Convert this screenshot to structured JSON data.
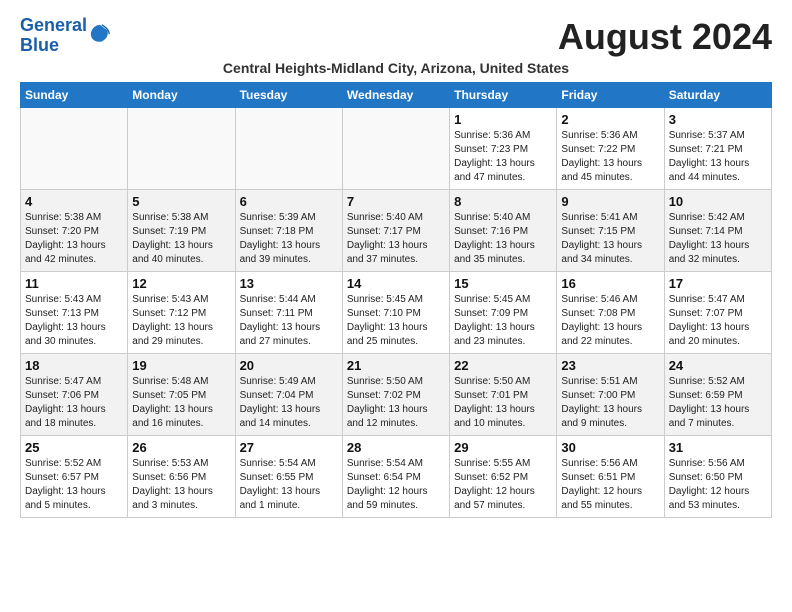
{
  "header": {
    "logo_line1": "General",
    "logo_line2": "Blue",
    "month": "August 2024",
    "location": "Central Heights-Midland City, Arizona, United States"
  },
  "weekdays": [
    "Sunday",
    "Monday",
    "Tuesday",
    "Wednesday",
    "Thursday",
    "Friday",
    "Saturday"
  ],
  "weeks": [
    [
      {
        "day": "",
        "sunrise": "",
        "sunset": "",
        "daylight": ""
      },
      {
        "day": "",
        "sunrise": "",
        "sunset": "",
        "daylight": ""
      },
      {
        "day": "",
        "sunrise": "",
        "sunset": "",
        "daylight": ""
      },
      {
        "day": "",
        "sunrise": "",
        "sunset": "",
        "daylight": ""
      },
      {
        "day": "1",
        "sunrise": "Sunrise: 5:36 AM",
        "sunset": "Sunset: 7:23 PM",
        "daylight": "Daylight: 13 hours and 47 minutes."
      },
      {
        "day": "2",
        "sunrise": "Sunrise: 5:36 AM",
        "sunset": "Sunset: 7:22 PM",
        "daylight": "Daylight: 13 hours and 45 minutes."
      },
      {
        "day": "3",
        "sunrise": "Sunrise: 5:37 AM",
        "sunset": "Sunset: 7:21 PM",
        "daylight": "Daylight: 13 hours and 44 minutes."
      }
    ],
    [
      {
        "day": "4",
        "sunrise": "Sunrise: 5:38 AM",
        "sunset": "Sunset: 7:20 PM",
        "daylight": "Daylight: 13 hours and 42 minutes."
      },
      {
        "day": "5",
        "sunrise": "Sunrise: 5:38 AM",
        "sunset": "Sunset: 7:19 PM",
        "daylight": "Daylight: 13 hours and 40 minutes."
      },
      {
        "day": "6",
        "sunrise": "Sunrise: 5:39 AM",
        "sunset": "Sunset: 7:18 PM",
        "daylight": "Daylight: 13 hours and 39 minutes."
      },
      {
        "day": "7",
        "sunrise": "Sunrise: 5:40 AM",
        "sunset": "Sunset: 7:17 PM",
        "daylight": "Daylight: 13 hours and 37 minutes."
      },
      {
        "day": "8",
        "sunrise": "Sunrise: 5:40 AM",
        "sunset": "Sunset: 7:16 PM",
        "daylight": "Daylight: 13 hours and 35 minutes."
      },
      {
        "day": "9",
        "sunrise": "Sunrise: 5:41 AM",
        "sunset": "Sunset: 7:15 PM",
        "daylight": "Daylight: 13 hours and 34 minutes."
      },
      {
        "day": "10",
        "sunrise": "Sunrise: 5:42 AM",
        "sunset": "Sunset: 7:14 PM",
        "daylight": "Daylight: 13 hours and 32 minutes."
      }
    ],
    [
      {
        "day": "11",
        "sunrise": "Sunrise: 5:43 AM",
        "sunset": "Sunset: 7:13 PM",
        "daylight": "Daylight: 13 hours and 30 minutes."
      },
      {
        "day": "12",
        "sunrise": "Sunrise: 5:43 AM",
        "sunset": "Sunset: 7:12 PM",
        "daylight": "Daylight: 13 hours and 29 minutes."
      },
      {
        "day": "13",
        "sunrise": "Sunrise: 5:44 AM",
        "sunset": "Sunset: 7:11 PM",
        "daylight": "Daylight: 13 hours and 27 minutes."
      },
      {
        "day": "14",
        "sunrise": "Sunrise: 5:45 AM",
        "sunset": "Sunset: 7:10 PM",
        "daylight": "Daylight: 13 hours and 25 minutes."
      },
      {
        "day": "15",
        "sunrise": "Sunrise: 5:45 AM",
        "sunset": "Sunset: 7:09 PM",
        "daylight": "Daylight: 13 hours and 23 minutes."
      },
      {
        "day": "16",
        "sunrise": "Sunrise: 5:46 AM",
        "sunset": "Sunset: 7:08 PM",
        "daylight": "Daylight: 13 hours and 22 minutes."
      },
      {
        "day": "17",
        "sunrise": "Sunrise: 5:47 AM",
        "sunset": "Sunset: 7:07 PM",
        "daylight": "Daylight: 13 hours and 20 minutes."
      }
    ],
    [
      {
        "day": "18",
        "sunrise": "Sunrise: 5:47 AM",
        "sunset": "Sunset: 7:06 PM",
        "daylight": "Daylight: 13 hours and 18 minutes."
      },
      {
        "day": "19",
        "sunrise": "Sunrise: 5:48 AM",
        "sunset": "Sunset: 7:05 PM",
        "daylight": "Daylight: 13 hours and 16 minutes."
      },
      {
        "day": "20",
        "sunrise": "Sunrise: 5:49 AM",
        "sunset": "Sunset: 7:04 PM",
        "daylight": "Daylight: 13 hours and 14 minutes."
      },
      {
        "day": "21",
        "sunrise": "Sunrise: 5:50 AM",
        "sunset": "Sunset: 7:02 PM",
        "daylight": "Daylight: 13 hours and 12 minutes."
      },
      {
        "day": "22",
        "sunrise": "Sunrise: 5:50 AM",
        "sunset": "Sunset: 7:01 PM",
        "daylight": "Daylight: 13 hours and 10 minutes."
      },
      {
        "day": "23",
        "sunrise": "Sunrise: 5:51 AM",
        "sunset": "Sunset: 7:00 PM",
        "daylight": "Daylight: 13 hours and 9 minutes."
      },
      {
        "day": "24",
        "sunrise": "Sunrise: 5:52 AM",
        "sunset": "Sunset: 6:59 PM",
        "daylight": "Daylight: 13 hours and 7 minutes."
      }
    ],
    [
      {
        "day": "25",
        "sunrise": "Sunrise: 5:52 AM",
        "sunset": "Sunset: 6:57 PM",
        "daylight": "Daylight: 13 hours and 5 minutes."
      },
      {
        "day": "26",
        "sunrise": "Sunrise: 5:53 AM",
        "sunset": "Sunset: 6:56 PM",
        "daylight": "Daylight: 13 hours and 3 minutes."
      },
      {
        "day": "27",
        "sunrise": "Sunrise: 5:54 AM",
        "sunset": "Sunset: 6:55 PM",
        "daylight": "Daylight: 13 hours and 1 minute."
      },
      {
        "day": "28",
        "sunrise": "Sunrise: 5:54 AM",
        "sunset": "Sunset: 6:54 PM",
        "daylight": "Daylight: 12 hours and 59 minutes."
      },
      {
        "day": "29",
        "sunrise": "Sunrise: 5:55 AM",
        "sunset": "Sunset: 6:52 PM",
        "daylight": "Daylight: 12 hours and 57 minutes."
      },
      {
        "day": "30",
        "sunrise": "Sunrise: 5:56 AM",
        "sunset": "Sunset: 6:51 PM",
        "daylight": "Daylight: 12 hours and 55 minutes."
      },
      {
        "day": "31",
        "sunrise": "Sunrise: 5:56 AM",
        "sunset": "Sunset: 6:50 PM",
        "daylight": "Daylight: 12 hours and 53 minutes."
      }
    ]
  ]
}
